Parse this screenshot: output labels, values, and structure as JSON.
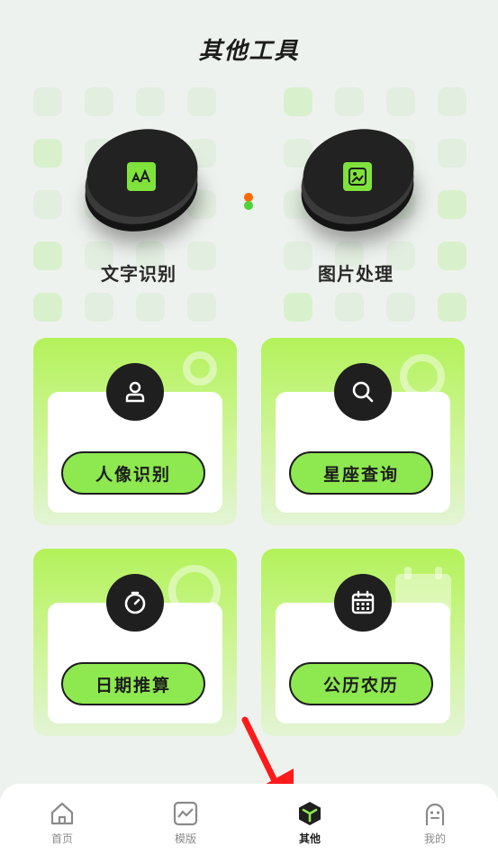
{
  "page_title": "其他工具",
  "featured": [
    {
      "label": "文字识别",
      "icon": "text-recognition-icon",
      "icon_text": "ᴬA"
    },
    {
      "label": "图片处理",
      "icon": "image-edit-icon"
    }
  ],
  "tools": [
    {
      "label": "人像识别",
      "icon": "person-icon"
    },
    {
      "label": "星座查询",
      "icon": "search-icon"
    },
    {
      "label": "日期推算",
      "icon": "stopwatch-icon"
    },
    {
      "label": "公历农历",
      "icon": "calendar-icon"
    }
  ],
  "tabbar": {
    "items": [
      {
        "label": "首页",
        "icon": "home-icon"
      },
      {
        "label": "模版",
        "icon": "template-icon"
      },
      {
        "label": "其他",
        "icon": "other-icon",
        "active": true
      },
      {
        "label": "我的",
        "icon": "profile-icon"
      }
    ]
  },
  "colors": {
    "accent": "#8ee84f",
    "card_top": "#b3f25a",
    "dark": "#1f1f1f",
    "arrow": "#ff1a1a",
    "dot_orange": "#ff6a00",
    "dot_green": "#4fd23a"
  }
}
